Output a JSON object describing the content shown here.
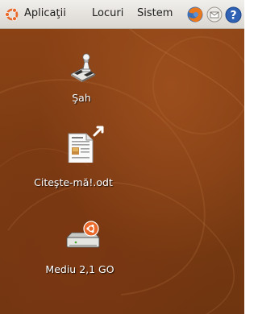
{
  "top_panel": {
    "menus": [
      {
        "label": "Aplicaţii"
      },
      {
        "label": "Locuri"
      },
      {
        "label": "Sistem"
      }
    ],
    "launchers": [
      "firefox-icon",
      "mail-icon",
      "help-icon"
    ]
  },
  "desktop": {
    "icons": [
      {
        "label": "Şah",
        "icon": "chess-icon"
      },
      {
        "label": "Citeşte-mă!.odt",
        "icon": "document-link-icon"
      },
      {
        "label": "Mediu 2,1 GO",
        "icon": "drive-icon"
      }
    ]
  },
  "colors": {
    "panel": "#e6e2dd",
    "desktop": "#7e3c12",
    "ubuntu_orange": "#e9682a"
  }
}
